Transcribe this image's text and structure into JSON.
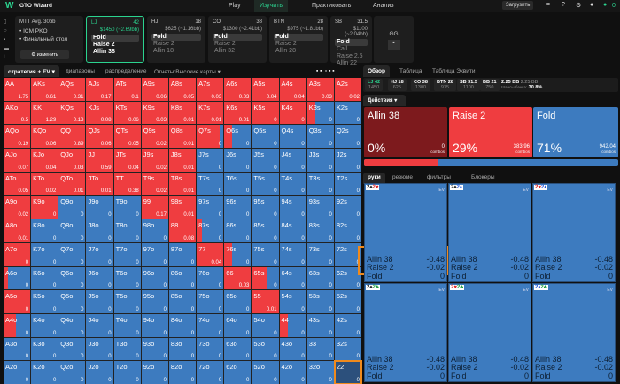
{
  "nav": {
    "logo": "W",
    "title": "GTO Wizard",
    "items": [
      "Play",
      "Изучить",
      "Практиковать",
      "Анализ"
    ],
    "active": 1,
    "upload": "Загрузить",
    "coins": "0"
  },
  "setup": {
    "format": "MTT",
    "avg": "Avg. 30bb",
    "lines": [
      "• ICM PKO",
      "• Финальный стол"
    ],
    "edit": "изменить"
  },
  "positions": [
    {
      "pos": "LJ",
      "bb": "42",
      "stack": "$1450 (~2.69bb)",
      "actions": [
        "Fold",
        "Raise 2",
        "Allin 38"
      ],
      "selected": 0
    },
    {
      "pos": "HJ",
      "bb": "18",
      "stack": "$625 (~1.16bb)",
      "actions": [
        "Fold",
        "Raise 2",
        "Allin 18"
      ],
      "selected": 0
    },
    {
      "pos": "CO",
      "bb": "38",
      "stack": "$1300 (~2.41bb)",
      "actions": [
        "Fold",
        "Raise 2",
        "Allin 32"
      ],
      "selected": 0
    },
    {
      "pos": "BTN",
      "bb": "28",
      "stack": "$975 (~1.81bb)",
      "actions": [
        "Fold",
        "Raise 2",
        "Allin 28"
      ],
      "selected": 0
    },
    {
      "pos": "SB",
      "bb": "31.5",
      "stack": "$1100 (~2.04bb)",
      "actions": [
        "Fold",
        "Call",
        "Raise 2.5",
        "Allin 22"
      ],
      "selected": 0
    }
  ],
  "gg": "GG",
  "left_tabs": [
    "стратегия + EV ▾",
    "диапазоны",
    "распределение",
    "Отчеты:Высокие карты ▾"
  ],
  "colors": {
    "raise": "#ef3d40",
    "fold": "#3d7bbf",
    "allin": "#7d1a1d",
    "accent": "#2bd38f",
    "highlight": "#f08a1c"
  },
  "grid": {
    "labels": [
      [
        "AA",
        "AKs",
        "AQs",
        "AJs",
        "ATs",
        "A9s",
        "A8s",
        "A7s",
        "A6s",
        "A5s",
        "A4s",
        "A3s",
        "A2s"
      ],
      [
        "AKo",
        "KK",
        "KQs",
        "KJs",
        "KTs",
        "K9s",
        "K8s",
        "K7s",
        "K6s",
        "K5s",
        "K4s",
        "K3s",
        "K2s"
      ],
      [
        "AQo",
        "KQo",
        "QQ",
        "QJs",
        "QTs",
        "Q9s",
        "Q8s",
        "Q7s",
        "Q6s",
        "Q5s",
        "Q4s",
        "Q3s",
        "Q2s"
      ],
      [
        "AJo",
        "KJo",
        "QJo",
        "JJ",
        "JTs",
        "J9s",
        "J8s",
        "J7s",
        "J6s",
        "J5s",
        "J4s",
        "J3s",
        "J2s"
      ],
      [
        "ATo",
        "KTo",
        "QTo",
        "JTo",
        "TT",
        "T9s",
        "T8s",
        "T7s",
        "T6s",
        "T5s",
        "T4s",
        "T3s",
        "T2s"
      ],
      [
        "A9o",
        "K9o",
        "Q9o",
        "J9o",
        "T9o",
        "99",
        "98s",
        "97s",
        "96s",
        "95s",
        "94s",
        "93s",
        "92s"
      ],
      [
        "A8o",
        "K8o",
        "Q8o",
        "J8o",
        "T8o",
        "98o",
        "88",
        "87s",
        "86s",
        "85s",
        "84s",
        "83s",
        "82s"
      ],
      [
        "A7o",
        "K7o",
        "Q7o",
        "J7o",
        "T7o",
        "97o",
        "87o",
        "77",
        "76s",
        "75s",
        "74s",
        "73s",
        "72s"
      ],
      [
        "A6o",
        "K6o",
        "Q6o",
        "J6o",
        "T6o",
        "96o",
        "86o",
        "76o",
        "66",
        "65s",
        "64s",
        "63s",
        "62s"
      ],
      [
        "A5o",
        "K5o",
        "Q5o",
        "J5o",
        "T5o",
        "95o",
        "85o",
        "75o",
        "65o",
        "55",
        "54s",
        "53s",
        "52s"
      ],
      [
        "A4o",
        "K4o",
        "Q4o",
        "J4o",
        "T4o",
        "94o",
        "84o",
        "74o",
        "64o",
        "54o",
        "44",
        "43s",
        "42s"
      ],
      [
        "A3o",
        "K3o",
        "Q3o",
        "J3o",
        "T3o",
        "93o",
        "83o",
        "73o",
        "63o",
        "53o",
        "43o",
        "33",
        "32s"
      ],
      [
        "A2o",
        "K2o",
        "Q2o",
        "J2o",
        "T2o",
        "92o",
        "82o",
        "72o",
        "62o",
        "52o",
        "42o",
        "32o",
        "22"
      ]
    ],
    "ev": [
      [
        1.75,
        0.61,
        0.31,
        0.17,
        0.1,
        0.06,
        0.05,
        0.03,
        0.03,
        0.04,
        0.04,
        0.03,
        0.02
      ],
      [
        0.5,
        1.29,
        0.13,
        0.08,
        0.06,
        0.03,
        0.01,
        0.01,
        0.01,
        0,
        0,
        0,
        0
      ],
      [
        0.19,
        0.06,
        0.89,
        0.06,
        0.05,
        0.02,
        0.01,
        0,
        0,
        0,
        0,
        0,
        0
      ],
      [
        0.07,
        0.04,
        0.03,
        0.59,
        0.04,
        0.02,
        0.01,
        0,
        0,
        0,
        0,
        0,
        0
      ],
      [
        0.05,
        0.02,
        0.01,
        0.01,
        0.38,
        0.02,
        0.01,
        0,
        0,
        0,
        0,
        0,
        0
      ],
      [
        0.02,
        0,
        0,
        0,
        0,
        0.17,
        0.01,
        0,
        0,
        0,
        0,
        0,
        0
      ],
      [
        0.01,
        0,
        0,
        0,
        0,
        0,
        0.08,
        0,
        0,
        0,
        0,
        0,
        0
      ],
      [
        0,
        0,
        0,
        0,
        0,
        0,
        0,
        0.04,
        0,
        0,
        0,
        0,
        0
      ],
      [
        0,
        0,
        0,
        0,
        0,
        0,
        0,
        0,
        0.03,
        0,
        0,
        0,
        0
      ],
      [
        0,
        0,
        0,
        0,
        0,
        0,
        0,
        0,
        0,
        0.01,
        0,
        0,
        0
      ],
      [
        0,
        0,
        0,
        0,
        0,
        0,
        0,
        0,
        0,
        0,
        0,
        0,
        0
      ],
      [
        0,
        0,
        0,
        0,
        0,
        0,
        0,
        0,
        0,
        0,
        0,
        0,
        0
      ],
      [
        0,
        0,
        0,
        0,
        0,
        0,
        0,
        0,
        0,
        0,
        0,
        0,
        0
      ]
    ],
    "raise_freq": [
      [
        1,
        1,
        1,
        1,
        1,
        1,
        1,
        1,
        1,
        1,
        1,
        1,
        1
      ],
      [
        1,
        1,
        1,
        1,
        1,
        1,
        1,
        1,
        1,
        1,
        1,
        0.3,
        0
      ],
      [
        1,
        1,
        1,
        1,
        1,
        1,
        1,
        0.85,
        0.3,
        0,
        0,
        0,
        0
      ],
      [
        1,
        1,
        1,
        1,
        1,
        1,
        1,
        0,
        0,
        0,
        0,
        0,
        0
      ],
      [
        1,
        1,
        1,
        1,
        1,
        1,
        1,
        0,
        0,
        0,
        0,
        0,
        0
      ],
      [
        1,
        1,
        0,
        0,
        0,
        1,
        1,
        0,
        0,
        0,
        0,
        0,
        0
      ],
      [
        1,
        0,
        0,
        0,
        0,
        0,
        1,
        0.2,
        0,
        0,
        0,
        0,
        0
      ],
      [
        1,
        0,
        0,
        0,
        0,
        0,
        0,
        1,
        0.3,
        0,
        0,
        0,
        0
      ],
      [
        0.15,
        0,
        0,
        0,
        0,
        0,
        0,
        0,
        1,
        0.55,
        0,
        0,
        0
      ],
      [
        1,
        0,
        0,
        0,
        0,
        0,
        0,
        0,
        0,
        1,
        0,
        0,
        0
      ],
      [
        0.45,
        0,
        0,
        0,
        0,
        0,
        0,
        0,
        0,
        0,
        0.3,
        0,
        0
      ],
      [
        0,
        0,
        0,
        0,
        0,
        0,
        0,
        0,
        0,
        0,
        0,
        0,
        0
      ],
      [
        0,
        0,
        0,
        0,
        0,
        0,
        0,
        0,
        0,
        0,
        0,
        0,
        0
      ]
    ],
    "selected": "22"
  },
  "right_tabs": [
    "Обзор",
    "Таблица",
    "Таблица Эквити"
  ],
  "stacks": [
    {
      "pos": "LJ 42",
      "chips": "1450"
    },
    {
      "pos": "HJ 18",
      "chips": "625"
    },
    {
      "pos": "CO 38",
      "chips": "1300"
    },
    {
      "pos": "BTN 28",
      "chips": "975"
    },
    {
      "pos": "SB 31.5",
      "chips": "1100"
    },
    {
      "pos": "BB 21",
      "chips": "750"
    }
  ],
  "pot": {
    "a": "2.25 BB",
    "b": "2.25 BB",
    "label": "Шансы банка:",
    "odds": "30.8%"
  },
  "actions_dd": "Действия ▾",
  "actions": [
    {
      "name": "Allin 38",
      "pct": "0%",
      "combos": "0",
      "freq": 0
    },
    {
      "name": "Raise 2",
      "pct": "29%",
      "combos": "383.96",
      "freq": 29
    },
    {
      "name": "Fold",
      "pct": "71%",
      "combos": "942.04",
      "freq": 71
    }
  ],
  "combos_label": "combos",
  "hand_tabs": [
    "руки",
    "резюме",
    "фильтры",
    "Блокеры"
  ],
  "ev_label": "EV",
  "hands": [
    {
      "c1": "2♠",
      "c2": "2♥",
      "k1": "#222",
      "k2": "#d22"
    },
    {
      "c1": "2♠",
      "c2": "2♦",
      "k1": "#222",
      "k2": "#2255dd"
    },
    {
      "c1": "2♥",
      "c2": "2♦",
      "k1": "#d22",
      "k2": "#2255dd"
    },
    {
      "c1": "2♠",
      "c2": "2♣",
      "k1": "#222",
      "k2": "#1a9a3a"
    },
    {
      "c1": "2♥",
      "c2": "2♣",
      "k1": "#d22",
      "k2": "#1a9a3a"
    },
    {
      "c1": "2♦",
      "c2": "2♣",
      "k1": "#2255dd",
      "k2": "#1a9a3a"
    }
  ],
  "hand_rows": [
    {
      "a": "Allin 38",
      "v": "-0.48"
    },
    {
      "a": "Raise 2",
      "v": "-0.02"
    },
    {
      "a": "Fold",
      "v": "0"
    }
  ]
}
